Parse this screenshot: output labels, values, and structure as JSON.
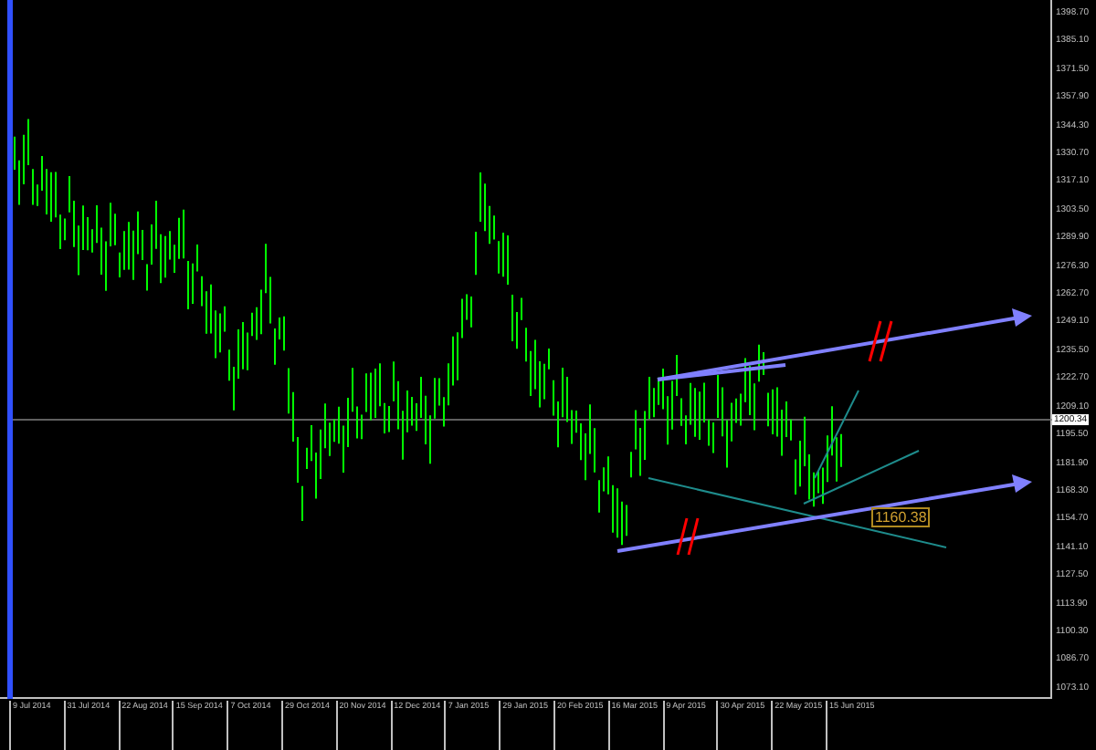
{
  "chart": {
    "price_axis": [
      "1398.70",
      "1385.10",
      "1371.50",
      "1357.90",
      "1344.30",
      "1330.70",
      "1317.10",
      "1303.50",
      "1289.90",
      "1276.30",
      "1262.70",
      "1249.10",
      "1235.50",
      "1222.70",
      "1209.10",
      "1195.50",
      "1181.90",
      "1168.30",
      "1154.70",
      "1141.10",
      "1127.50",
      "1113.90",
      "1100.30",
      "1086.70",
      "1073.10"
    ],
    "current_price": "1200.34",
    "date_axis": [
      "9 Jul 2014",
      "31 Jul 2014",
      "22 Aug 2014",
      "15 Sep 2014",
      "7 Oct 2014",
      "29 Oct 2014",
      "20 Nov 2014",
      "12 Dec 2014",
      "7 Jan 2015",
      "29 Jan 2015",
      "20 Feb 2015",
      "16 Mar 2015",
      "9 Apr 2015",
      "30 Apr 2015",
      "22 May 2015",
      "15 Jun 2015"
    ],
    "price_label": "1160.38"
  }
}
